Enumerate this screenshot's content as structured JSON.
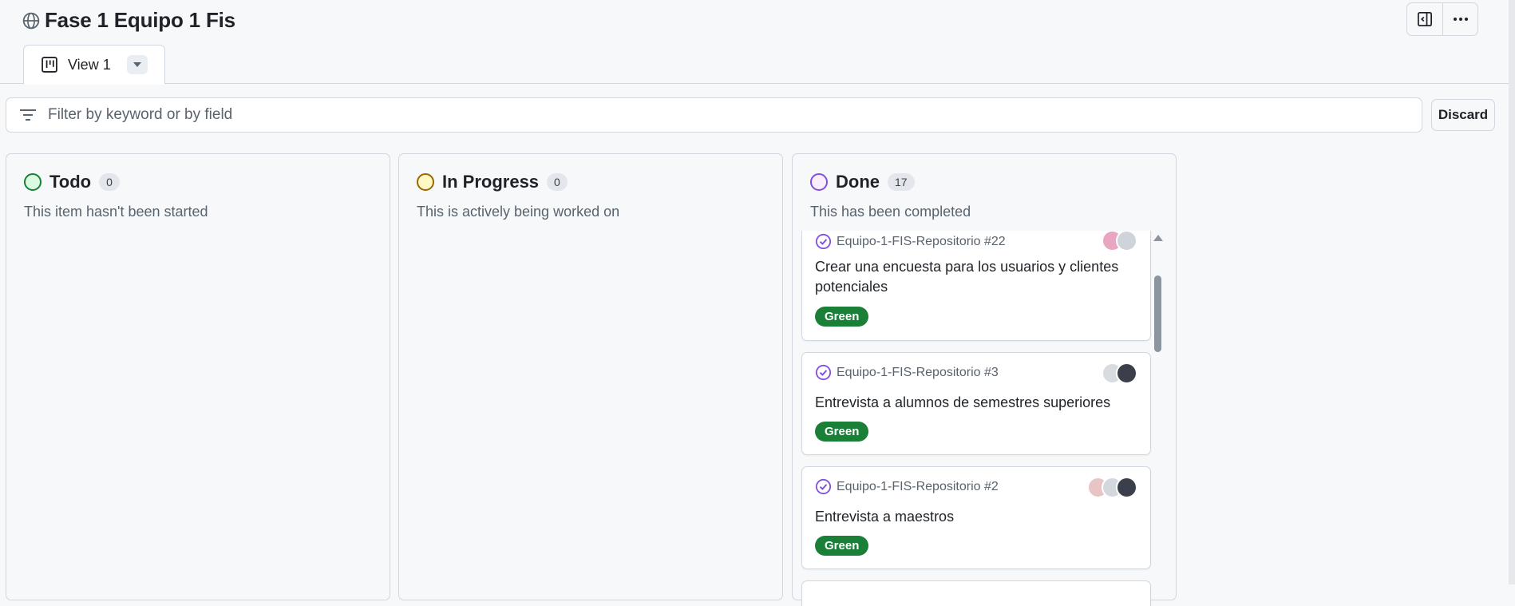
{
  "header": {
    "title": "Fase 1 Equipo 1 Fis",
    "globe_icon": "globe-icon",
    "actions": [
      {
        "name": "panel-toggle-button",
        "icon": "sidebar-panel-icon"
      },
      {
        "name": "more-options-button",
        "icon": "kebab-horizontal-icon"
      }
    ]
  },
  "tabs": [
    {
      "label": "View 1",
      "icon": "board-icon",
      "dropdown_icon": "triangle-down-icon"
    }
  ],
  "filter": {
    "placeholder": "Filter by keyword or by field",
    "value": "",
    "icon": "filter-icon"
  },
  "discard_label": "Discard",
  "columns": [
    {
      "name": "Todo",
      "count": "0",
      "description": "This item hasn't been started",
      "color": "#1a7f37",
      "fill": "#dafbe1"
    },
    {
      "name": "In Progress",
      "count": "0",
      "description": "This is actively being worked on",
      "color": "#9a6700",
      "fill": "#fff8c5"
    },
    {
      "name": "Done",
      "count": "17",
      "description": "This has been completed",
      "color": "#8250df",
      "fill": "#fbefff"
    }
  ],
  "done_cards": [
    {
      "repo": "Equipo-1-FIS-Repositorio #22",
      "title": "Crear una encuesta para los usuarios y clientes potenciales",
      "label": "Green",
      "status_icon": "issue-closed-icon"
    },
    {
      "repo": "Equipo-1-FIS-Repositorio #3",
      "title": "Entrevista a alumnos de semestres superiores",
      "label": "Green",
      "status_icon": "issue-closed-icon"
    },
    {
      "repo": "Equipo-1-FIS-Repositorio #2",
      "title": "Entrevista a maestros",
      "label": "Green",
      "status_icon": "issue-closed-icon"
    }
  ],
  "colors": {
    "label_green": "#1a7f37",
    "done_purple": "#8250df",
    "border": "#d0d7de"
  }
}
